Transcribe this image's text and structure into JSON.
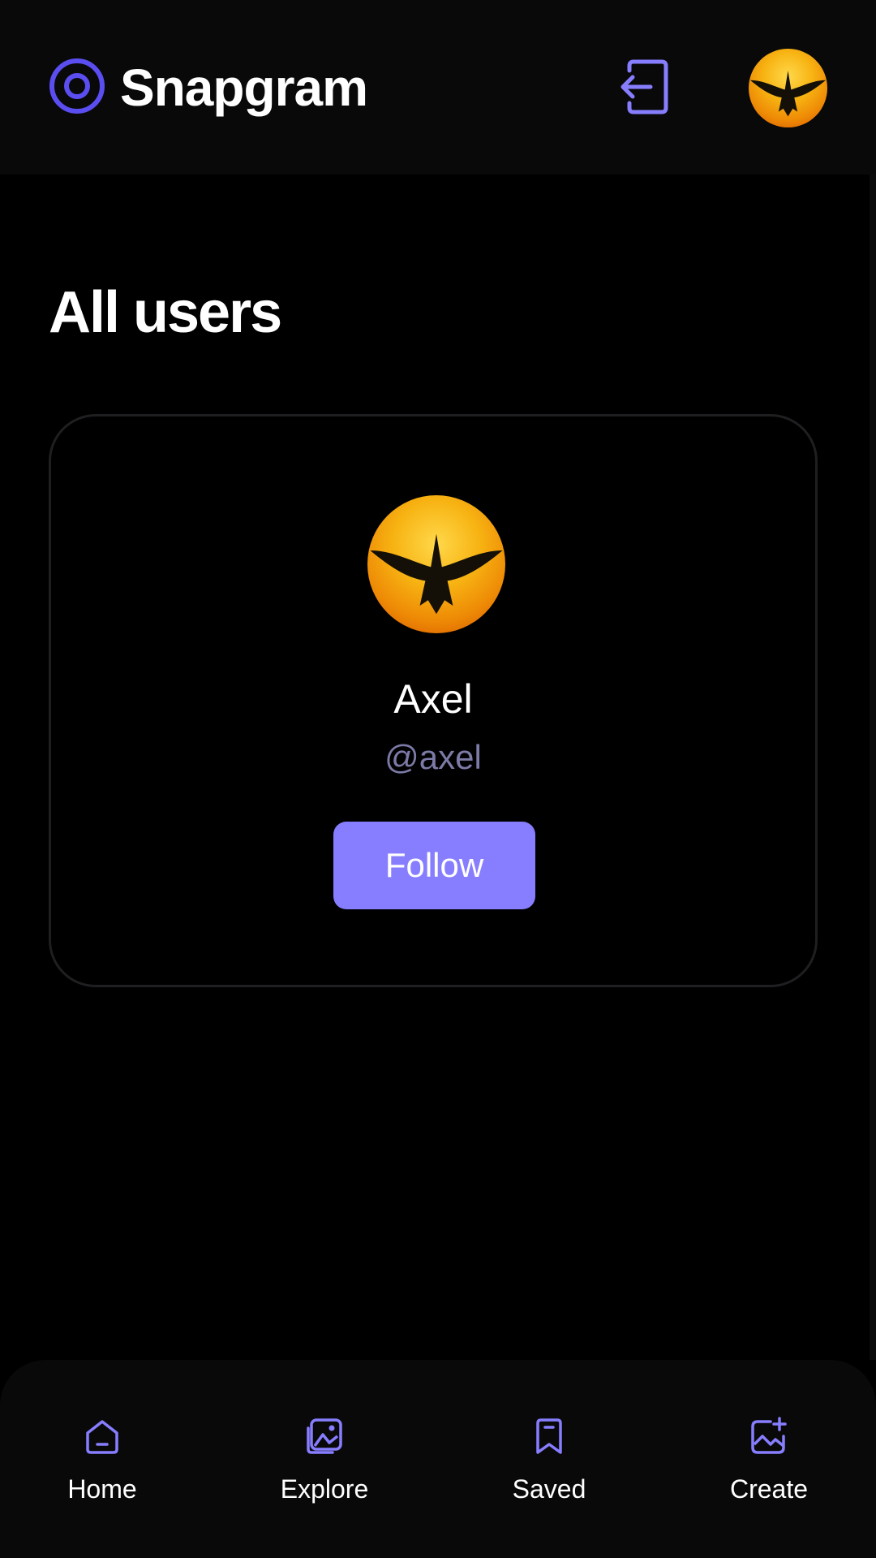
{
  "app": {
    "name": "Snapgram",
    "logo_icon": "ring-logo-icon",
    "accent_color": "#877eff"
  },
  "header": {
    "logout_icon": "logout-icon",
    "avatar_image": "eagle-silhouette-sunset"
  },
  "page": {
    "title": "All users"
  },
  "users": [
    {
      "name": "Axel",
      "handle": "@axel",
      "avatar_image": "eagle-silhouette-sunset",
      "follow_label": "Follow"
    }
  ],
  "bottom_nav": {
    "items": [
      {
        "label": "Home",
        "icon": "home-icon"
      },
      {
        "label": "Explore",
        "icon": "explore-icon"
      },
      {
        "label": "Saved",
        "icon": "bookmark-icon"
      },
      {
        "label": "Create",
        "icon": "create-post-icon"
      }
    ]
  }
}
